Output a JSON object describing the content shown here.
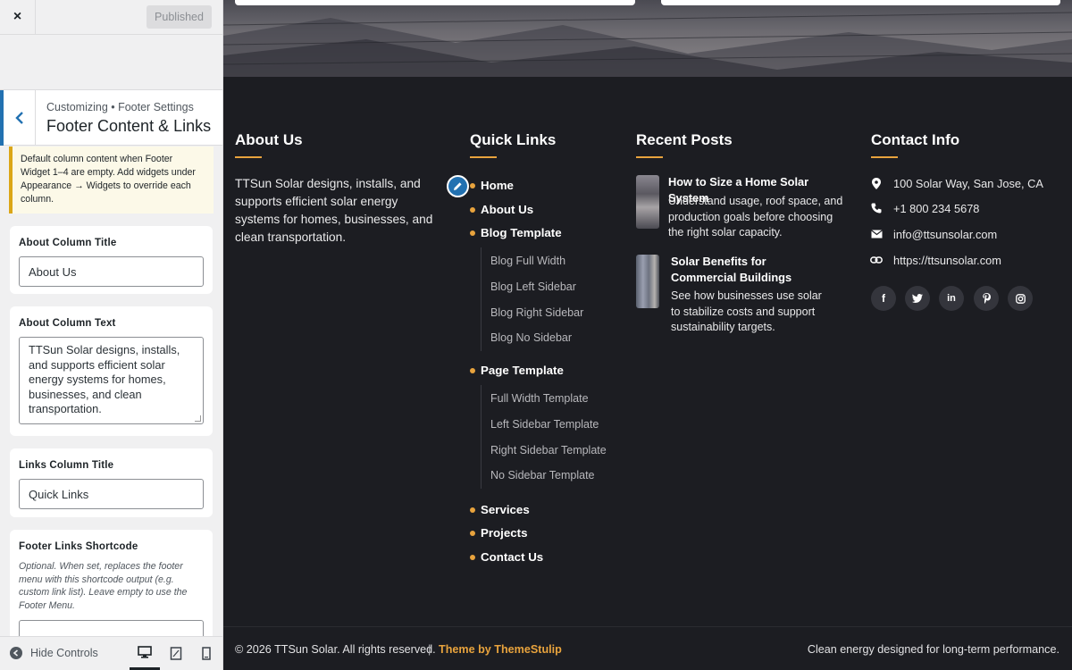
{
  "customizer": {
    "close_label": "×",
    "publish_label": "Published",
    "breadcrumb": "Customizing • Footer Settings",
    "section_title": "Footer Content & Links",
    "notice": "Default column content when Footer Widget 1–4 are empty. Add widgets under Appearance → Widgets to override each column.",
    "about_title": {
      "label": "About Column Title",
      "value": "About Us"
    },
    "about_text": {
      "label": "About Column Text",
      "value": "TTSun Solar designs, installs, and supports efficient solar energy systems for homes, businesses, and clean transportation."
    },
    "links_title": {
      "label": "Links Column Title",
      "value": "Quick Links"
    },
    "shortcode": {
      "label": "Footer Links Shortcode",
      "description": "Optional. When set, replaces the footer menu with this shortcode output (e.g. custom link list). Leave empty to use the Footer Menu.",
      "value": ""
    },
    "hide_controls": "Hide Controls",
    "devices": [
      "desktop",
      "tablet",
      "mobile"
    ],
    "active_device": "desktop"
  },
  "footer": {
    "about": {
      "heading": "About Us",
      "text": "TTSun Solar designs, installs, and supports efficient solar energy systems for homes, businesses, and clean transportation."
    },
    "quick_links": {
      "heading": "Quick Links",
      "items": [
        "Home",
        "About Us",
        "Blog Template",
        "Page Template",
        "Services",
        "Projects",
        "Contact Us"
      ],
      "blog_sub": [
        "Blog Full Width",
        "Blog Left Sidebar",
        "Blog Right Sidebar",
        "Blog No Sidebar"
      ],
      "page_sub": [
        "Full Width Template",
        "Left Sidebar Template",
        "Right Sidebar Template",
        "No Sidebar Template"
      ]
    },
    "recent_posts": {
      "heading": "Recent Posts",
      "posts": [
        {
          "title": "How to Size a Home Solar System",
          "excerpt": "Understand usage, roof space, and production goals before choosing the right solar capacity."
        },
        {
          "title": "Solar Benefits for Commercial Buildings",
          "excerpt": "See how businesses use solar to stabilize costs and support sustainability targets."
        }
      ]
    },
    "contact": {
      "heading": "Contact Info",
      "address": "100 Solar Way, San Jose, CA",
      "phone": "+1 800 234 5678",
      "email": "info@ttsunsolar.com",
      "website": "https://ttsunsolar.com",
      "social": [
        "facebook",
        "twitter",
        "linkedin",
        "pinterest",
        "instagram"
      ]
    },
    "bottom": {
      "copyright": "© 2026 TTSun Solar. All rights reserved.",
      "separator": "|",
      "theme_credit": "Theme by ThemeStulip",
      "tagline": "Clean energy designed for long-term performance."
    }
  },
  "colors": {
    "accent": "#e8a33d",
    "wp_blue": "#2271b1",
    "footer_bg": "#1c1d22"
  }
}
